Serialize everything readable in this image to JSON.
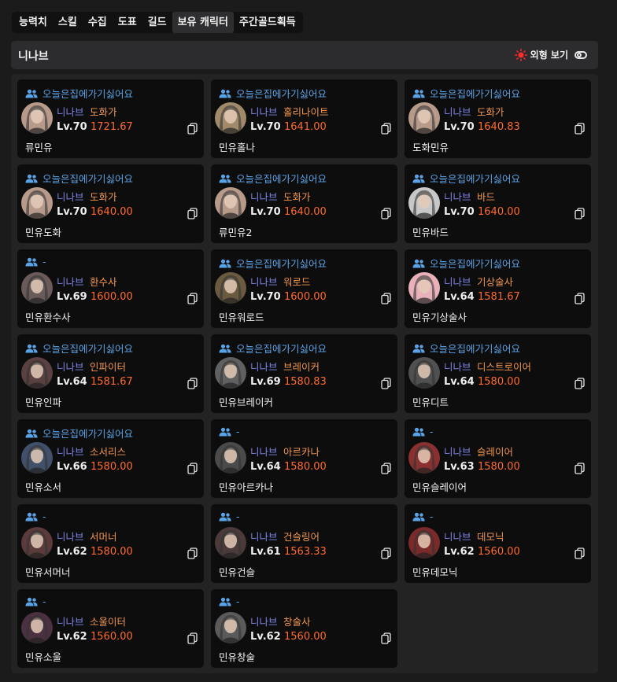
{
  "tabs": [
    {
      "label": "능력치",
      "active": false
    },
    {
      "label": "스킬",
      "active": false
    },
    {
      "label": "수집",
      "active": false
    },
    {
      "label": "도표",
      "active": false
    },
    {
      "label": "길드",
      "active": false
    },
    {
      "label": "보유 캐릭터",
      "active": true
    },
    {
      "label": "주간골드획득",
      "active": false
    }
  ],
  "header": {
    "title": "니나브",
    "appearance_label": "외형 보기",
    "appearance_icon": "sun-icon",
    "toggle_icon": "toggle-icon"
  },
  "colors": {
    "guild": "#5aa3e6",
    "server": "#7e86e8",
    "class": "#f0964f",
    "item_level": "#ff6a2e",
    "sun": "#ff2a2a"
  },
  "characters": [
    {
      "guild": "오늘은집에가기싫어요",
      "server": "니나브",
      "class": "도화가",
      "level": "Lv.70",
      "item_level": "1721.67",
      "name": "류민유",
      "avatar_color": "#b89a8a"
    },
    {
      "guild": "오늘은집에가기싫어요",
      "server": "니나브",
      "class": "홀리나이트",
      "level": "Lv.70",
      "item_level": "1641.00",
      "name": "민유홀나",
      "avatar_color": "#a08a6a"
    },
    {
      "guild": "오늘은집에가기싫어요",
      "server": "니나브",
      "class": "도화가",
      "level": "Lv.70",
      "item_level": "1640.83",
      "name": "도화민유",
      "avatar_color": "#b89a8a"
    },
    {
      "guild": "오늘은집에가기싫어요",
      "server": "니나브",
      "class": "도화가",
      "level": "Lv.70",
      "item_level": "1640.00",
      "name": "민유도화",
      "avatar_color": "#b89a8a"
    },
    {
      "guild": "오늘은집에가기싫어요",
      "server": "니나브",
      "class": "도화가",
      "level": "Lv.70",
      "item_level": "1640.00",
      "name": "류민유2",
      "avatar_color": "#b89a8a"
    },
    {
      "guild": "오늘은집에가기싫어요",
      "server": "니나브",
      "class": "바드",
      "level": "Lv.70",
      "item_level": "1640.00",
      "name": "민유바드",
      "avatar_color": "#c8c8c8"
    },
    {
      "guild": "-",
      "server": "니나브",
      "class": "환수사",
      "level": "Lv.69",
      "item_level": "1600.00",
      "name": "민유환수사",
      "avatar_color": "#6a5a5a"
    },
    {
      "guild": "오늘은집에가기싫어요",
      "server": "니나브",
      "class": "워로드",
      "level": "Lv.70",
      "item_level": "1600.00",
      "name": "민유워로드",
      "avatar_color": "#6a5a40"
    },
    {
      "guild": "오늘은집에가기싫어요",
      "server": "니나브",
      "class": "기상술사",
      "level": "Lv.64",
      "item_level": "1581.67",
      "name": "민유기상술사",
      "avatar_color": "#e8b0b8"
    },
    {
      "guild": "오늘은집에가기싫어요",
      "server": "니나브",
      "class": "인파이터",
      "level": "Lv.64",
      "item_level": "1581.67",
      "name": "민유인파",
      "avatar_color": "#5a4040"
    },
    {
      "guild": "오늘은집에가기싫어요",
      "server": "니나브",
      "class": "브레이커",
      "level": "Lv.69",
      "item_level": "1580.83",
      "name": "민유브레이커",
      "avatar_color": "#606060"
    },
    {
      "guild": "오늘은집에가기싫어요",
      "server": "니나브",
      "class": "디스트로이어",
      "level": "Lv.64",
      "item_level": "1580.00",
      "name": "민유디트",
      "avatar_color": "#505050"
    },
    {
      "guild": "오늘은집에가기싫어요",
      "server": "니나브",
      "class": "소서리스",
      "level": "Lv.66",
      "item_level": "1580.00",
      "name": "민유소서",
      "avatar_color": "#40506a"
    },
    {
      "guild": "-",
      "server": "니나브",
      "class": "아르카나",
      "level": "Lv.64",
      "item_level": "1580.00",
      "name": "민유아르카나",
      "avatar_color": "#4a4a4a"
    },
    {
      "guild": "-",
      "server": "니나브",
      "class": "슬레이어",
      "level": "Lv.63",
      "item_level": "1580.00",
      "name": "민유슬레이어",
      "avatar_color": "#8a3030"
    },
    {
      "guild": "-",
      "server": "니나브",
      "class": "서머너",
      "level": "Lv.62",
      "item_level": "1580.00",
      "name": "민유서머너",
      "avatar_color": "#5a3a3a"
    },
    {
      "guild": "-",
      "server": "니나브",
      "class": "건슬링어",
      "level": "Lv.61",
      "item_level": "1563.33",
      "name": "민유건슬",
      "avatar_color": "#4a3a3a"
    },
    {
      "guild": "-",
      "server": "니나브",
      "class": "데모닉",
      "level": "Lv.62",
      "item_level": "1560.00",
      "name": "민유데모닉",
      "avatar_color": "#7a2a2a"
    },
    {
      "guild": "-",
      "server": "니나브",
      "class": "소울이터",
      "level": "Lv.62",
      "item_level": "1560.00",
      "name": "민유소울",
      "avatar_color": "#4a3040"
    },
    {
      "guild": "-",
      "server": "니나브",
      "class": "창술사",
      "level": "Lv.62",
      "item_level": "1560.00",
      "name": "민유창술",
      "avatar_color": "#5a5a5a"
    }
  ]
}
